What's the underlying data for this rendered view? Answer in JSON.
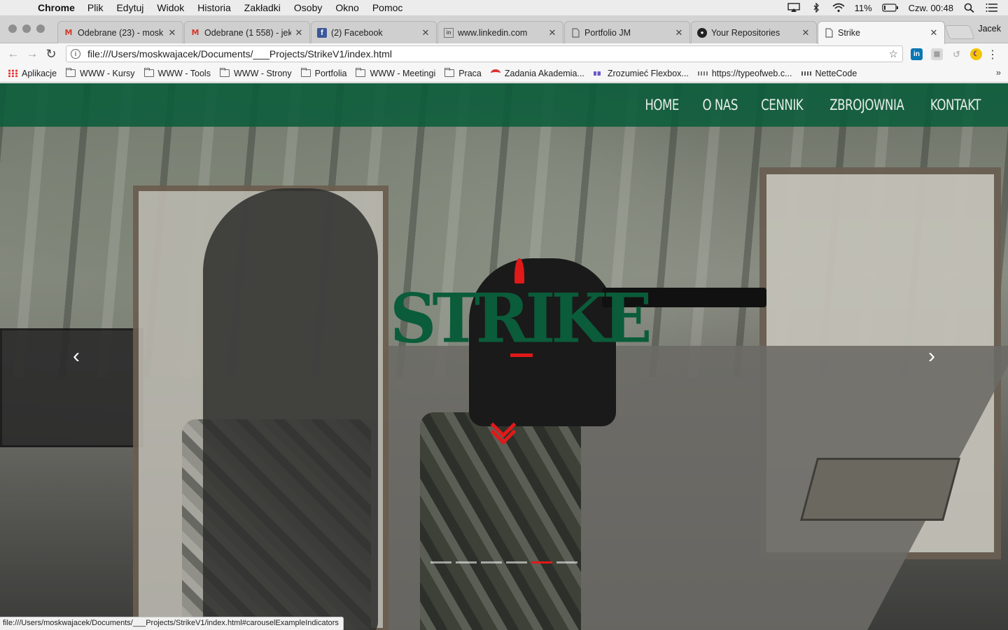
{
  "menubar": {
    "app_name": "Chrome",
    "menus": [
      "Plik",
      "Edytuj",
      "Widok",
      "Historia",
      "Zakładki",
      "Osoby",
      "Okno",
      "Pomoc"
    ],
    "battery": "11%",
    "clock": "Czw. 00:48"
  },
  "tabs": [
    {
      "title": "Odebrane (23) - mosk",
      "icon": "gmail-icon"
    },
    {
      "title": "Odebrane (1 558) - jek",
      "icon": "gmail-icon"
    },
    {
      "title": "(2) Facebook",
      "icon": "facebook-icon"
    },
    {
      "title": "www.linkedin.com",
      "icon": "linkedin-icon"
    },
    {
      "title": "Portfolio JM",
      "icon": "document-icon"
    },
    {
      "title": "Your Repositories",
      "icon": "github-icon"
    },
    {
      "title": "Strike",
      "icon": "document-icon",
      "active": true
    }
  ],
  "profile_name": "Jacek",
  "address_bar": {
    "url": "file:///Users/moskwajacek/Documents/___Projects/StrikeV1/index.html"
  },
  "bookmarks": [
    {
      "label": "Aplikacje",
      "icon": "apps-grid-icon"
    },
    {
      "label": "WWW - Kursy",
      "icon": "folder-icon"
    },
    {
      "label": "WWW - Tools",
      "icon": "folder-icon"
    },
    {
      "label": "WWW - Strony",
      "icon": "folder-icon"
    },
    {
      "label": "Portfolia",
      "icon": "folder-icon"
    },
    {
      "label": "WWW - Meetingi",
      "icon": "folder-icon"
    },
    {
      "label": "Praca",
      "icon": "folder-icon"
    },
    {
      "label": "Zadania Akademia...",
      "icon": "link-icon"
    },
    {
      "label": "Zrozumieć Flexbox...",
      "icon": "link-icon"
    },
    {
      "label": "https://typeofweb.c...",
      "icon": "link-icon"
    },
    {
      "label": "NetteCode",
      "icon": "link-icon"
    }
  ],
  "site": {
    "nav": [
      "HOME",
      "O NAS",
      "CENNIK",
      "ZBROJOWNIA",
      "KONTAKT"
    ],
    "logo_text": "STRIKE",
    "carousel_slide_count": 6,
    "carousel_active_index": 4,
    "colors": {
      "brand_green": "#0a5c3a",
      "accent_red": "#e01919"
    }
  },
  "status_bar": "file:///Users/moskwajacek/Documents/___Projects/StrikeV1/index.html#carouselExampleIndicators"
}
